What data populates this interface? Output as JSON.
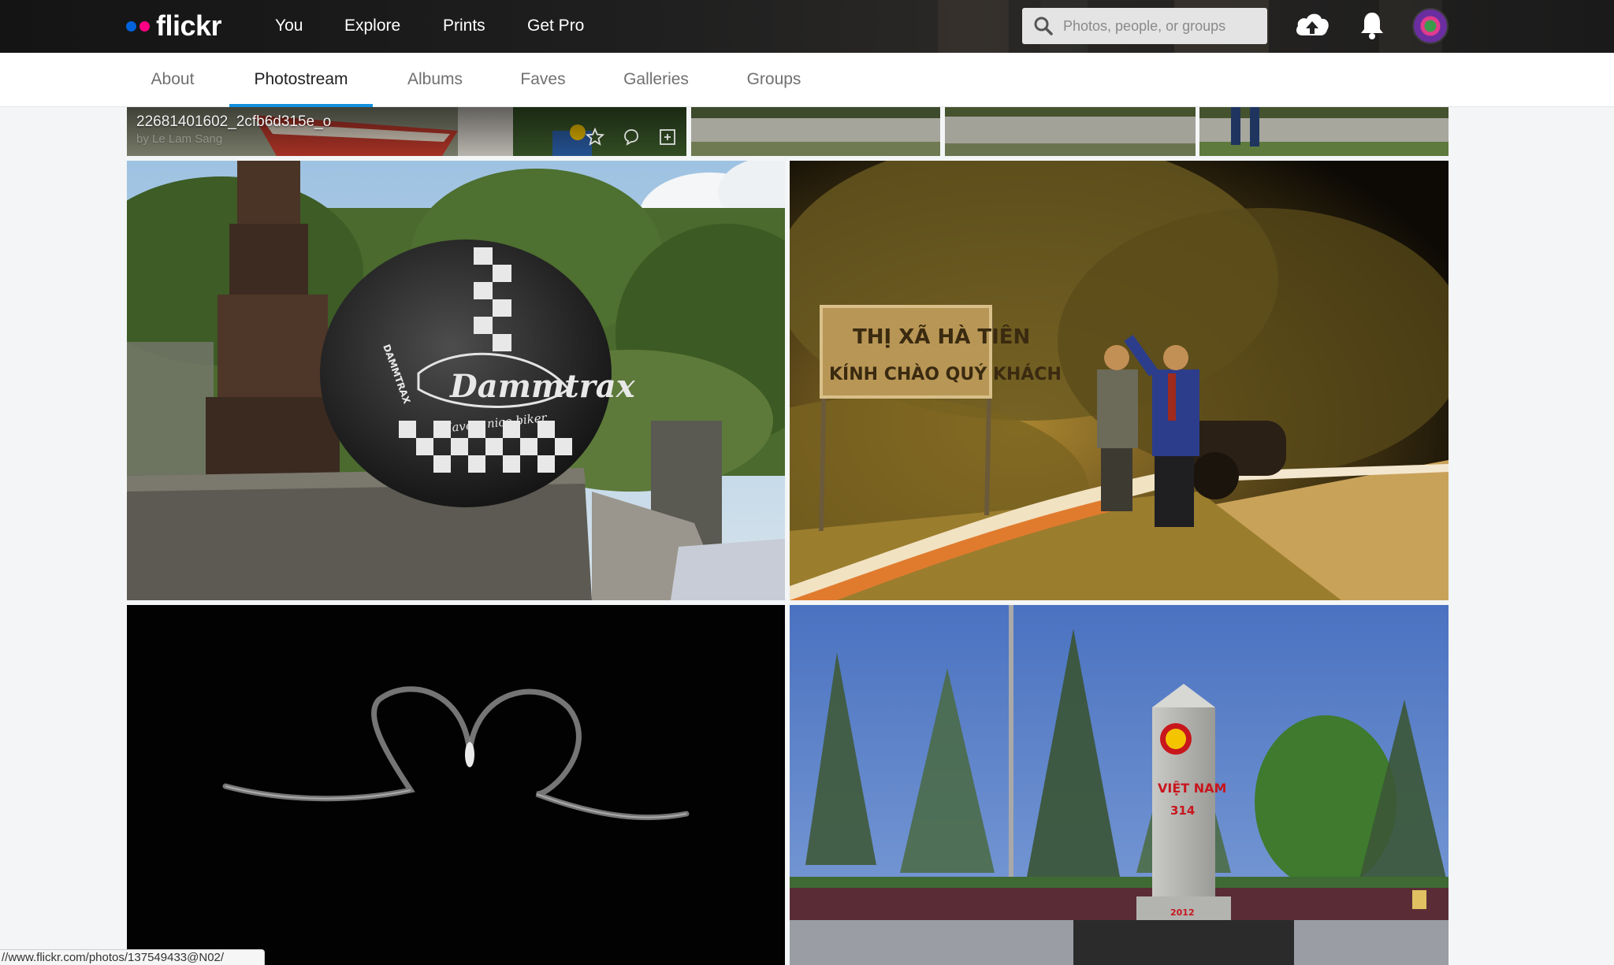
{
  "brand": {
    "name": "flickr",
    "colors": {
      "blue": "#0063dc",
      "pink": "#ff0084",
      "accent": "#128fdc"
    }
  },
  "topnav": {
    "items": [
      {
        "label": "You"
      },
      {
        "label": "Explore"
      },
      {
        "label": "Prints"
      },
      {
        "label": "Get Pro"
      }
    ]
  },
  "search": {
    "placeholder": "Photos, people, or groups",
    "icon": "search-icon"
  },
  "top_icons": [
    "upload-cloud-icon",
    "bell-icon",
    "avatar"
  ],
  "subnav": {
    "tabs": [
      {
        "label": "About",
        "active": false
      },
      {
        "label": "Photostream",
        "active": true
      },
      {
        "label": "Albums",
        "active": false
      },
      {
        "label": "Faves",
        "active": false
      },
      {
        "label": "Galleries",
        "active": false
      },
      {
        "label": "Groups",
        "active": false
      }
    ]
  },
  "photos": {
    "hovered": {
      "title": "22681401602_2cfb6d315e_o",
      "byline": "by Le Lam Sang",
      "icons": [
        "star-icon",
        "comment-icon",
        "add-to-gallery-icon"
      ]
    },
    "helmet": {
      "text_1": "Dammtrax",
      "text_2": "Have a nice biker",
      "text_3": "DAMMTRAX"
    },
    "night_sign": {
      "line_1": "THỊ XÃ HÀ TIÊN",
      "line_2": "KÍNH CHÀO QUÝ KHÁCH"
    },
    "border_marker": {
      "line_1": "VIỆT NAM",
      "line_2": "314",
      "line_3": "2012"
    }
  },
  "statusbar": {
    "url": "//www.flickr.com/photos/137549433@N02/"
  }
}
